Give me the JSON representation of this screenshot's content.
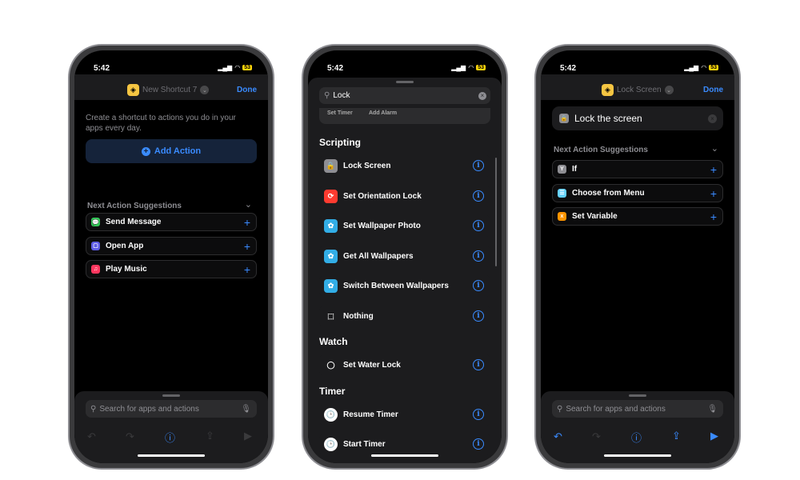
{
  "status": {
    "time": "5:42",
    "battery": "53"
  },
  "colors": {
    "accent": "#3a8bff",
    "background": "#000000",
    "card": "#1c1c1e"
  },
  "phone1": {
    "title": "New Shortcut 7",
    "done": "Done",
    "intro": "Create a shortcut to actions you do in your apps every day.",
    "add_action": "Add Action",
    "suggestions_title": "Next Action Suggestions",
    "suggestions": [
      {
        "label": "Send Message",
        "icon": "messages-icon",
        "color": "#34c759",
        "glyph": "💬"
      },
      {
        "label": "Open App",
        "icon": "open-app-icon",
        "color": "#5e5ce6",
        "glyph": "▢"
      },
      {
        "label": "Play Music",
        "icon": "music-icon",
        "color": "#ff375f",
        "glyph": "♫"
      }
    ],
    "search_placeholder": "Search for apps and actions"
  },
  "phone2": {
    "search_value": "Lock",
    "collapsed": [
      "Set Timer",
      "Add Alarm"
    ],
    "sections": [
      {
        "title": "Scripting",
        "items": [
          {
            "label": "Lock Screen",
            "icon": "lock-icon",
            "color": "#8e8e93",
            "glyph": "🔒"
          },
          {
            "label": "Set Orientation Lock",
            "icon": "orientation-lock-icon",
            "color": "#ff3b30",
            "glyph": "⟳"
          },
          {
            "label": "Set Wallpaper Photo",
            "icon": "wallpaper-icon",
            "color": "#32ade6",
            "glyph": "✿"
          },
          {
            "label": "Get All Wallpapers",
            "icon": "wallpaper-icon",
            "color": "#32ade6",
            "glyph": "✿"
          },
          {
            "label": "Switch Between Wallpapers",
            "icon": "wallpaper-icon",
            "color": "#32ade6",
            "glyph": "✿"
          },
          {
            "label": "Nothing",
            "icon": "nothing-icon",
            "color": "transparent",
            "glyph": "⬚"
          }
        ]
      },
      {
        "title": "Watch",
        "items": [
          {
            "label": "Set Water Lock",
            "icon": "watch-icon",
            "color": "transparent",
            "glyph": "◯"
          }
        ]
      },
      {
        "title": "Timer",
        "items": [
          {
            "label": "Resume Timer",
            "icon": "clock-icon",
            "color": "#ffffff",
            "glyph": "🕒"
          },
          {
            "label": "Start Timer",
            "icon": "clock-icon",
            "color": "#ffffff",
            "glyph": "🕒"
          }
        ]
      }
    ]
  },
  "phone3": {
    "title": "Lock Screen",
    "done": "Done",
    "action": "Lock the screen",
    "suggestions_title": "Next Action Suggestions",
    "suggestions": [
      {
        "label": "If",
        "icon": "if-icon",
        "color": "#8e8e93",
        "glyph": "Y"
      },
      {
        "label": "Choose from Menu",
        "icon": "menu-icon",
        "color": "#64d2ff",
        "glyph": "☰"
      },
      {
        "label": "Set Variable",
        "icon": "variable-icon",
        "color": "#ff9500",
        "glyph": "x"
      }
    ],
    "search_placeholder": "Search for apps and actions"
  }
}
